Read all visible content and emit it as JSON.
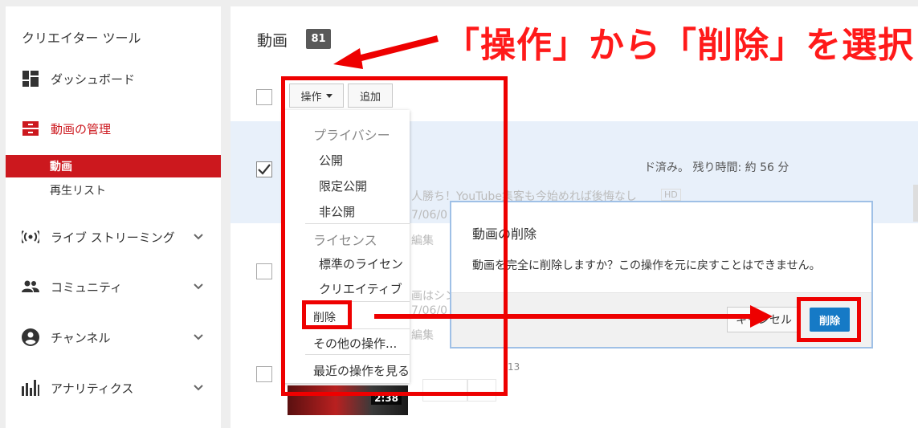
{
  "sidebar": {
    "title": "クリエイター ツール",
    "items": [
      {
        "label": "ダッシュボード",
        "icon": "dashboard-icon"
      },
      {
        "label": "動画の管理",
        "icon": "video-manager-icon",
        "active": true,
        "children": [
          {
            "label": "動画",
            "active": true
          },
          {
            "label": "再生リスト"
          }
        ]
      },
      {
        "label": "ライブ ストリーミング",
        "icon": "live-streaming-icon"
      },
      {
        "label": "コミュニティ",
        "icon": "community-icon"
      },
      {
        "label": "チャンネル",
        "icon": "channel-icon"
      },
      {
        "label": "アナリティクス",
        "icon": "analytics-icon"
      }
    ]
  },
  "main": {
    "title": "動画",
    "count": "81",
    "toolbar": {
      "actions_label": "操作",
      "add_label": "追加"
    },
    "rows": [
      {
        "status": "ド済み。 残り時間: 約 56 分",
        "title_fragment": "人勝ち！YouTube集客も今始めれば後悔なし",
        "badge": "HD",
        "date_fragment": "7/06/0",
        "edit_fragment": "編集"
      },
      {
        "title_fragment": "画はシン",
        "date_fragment": "7/06/0",
        "edit_fragment": "編集"
      },
      {
        "duration": "2:38",
        "fragment": "13"
      }
    ]
  },
  "menu": {
    "privacy_header": "プライバシー",
    "privacy_items": [
      "公開",
      "限定公開",
      "非公開"
    ],
    "license_header": "ライセンス",
    "license_items": [
      "標準のライセン",
      "クリエイティブ"
    ],
    "delete": "削除",
    "other_actions": "その他の操作...",
    "recent_actions": "最近の操作を見る..."
  },
  "dialog": {
    "title": "動画の削除",
    "message": "動画を完全に削除しますか？この操作を元に戻すことはできません。",
    "cancel_label": "キャンセル",
    "delete_label": "削除"
  },
  "annotation": {
    "text": "「操作」から「削除」を選択",
    "color": "#ee0000"
  },
  "colors": {
    "accent": "#cc181e",
    "primary_button": "#167ac6"
  }
}
